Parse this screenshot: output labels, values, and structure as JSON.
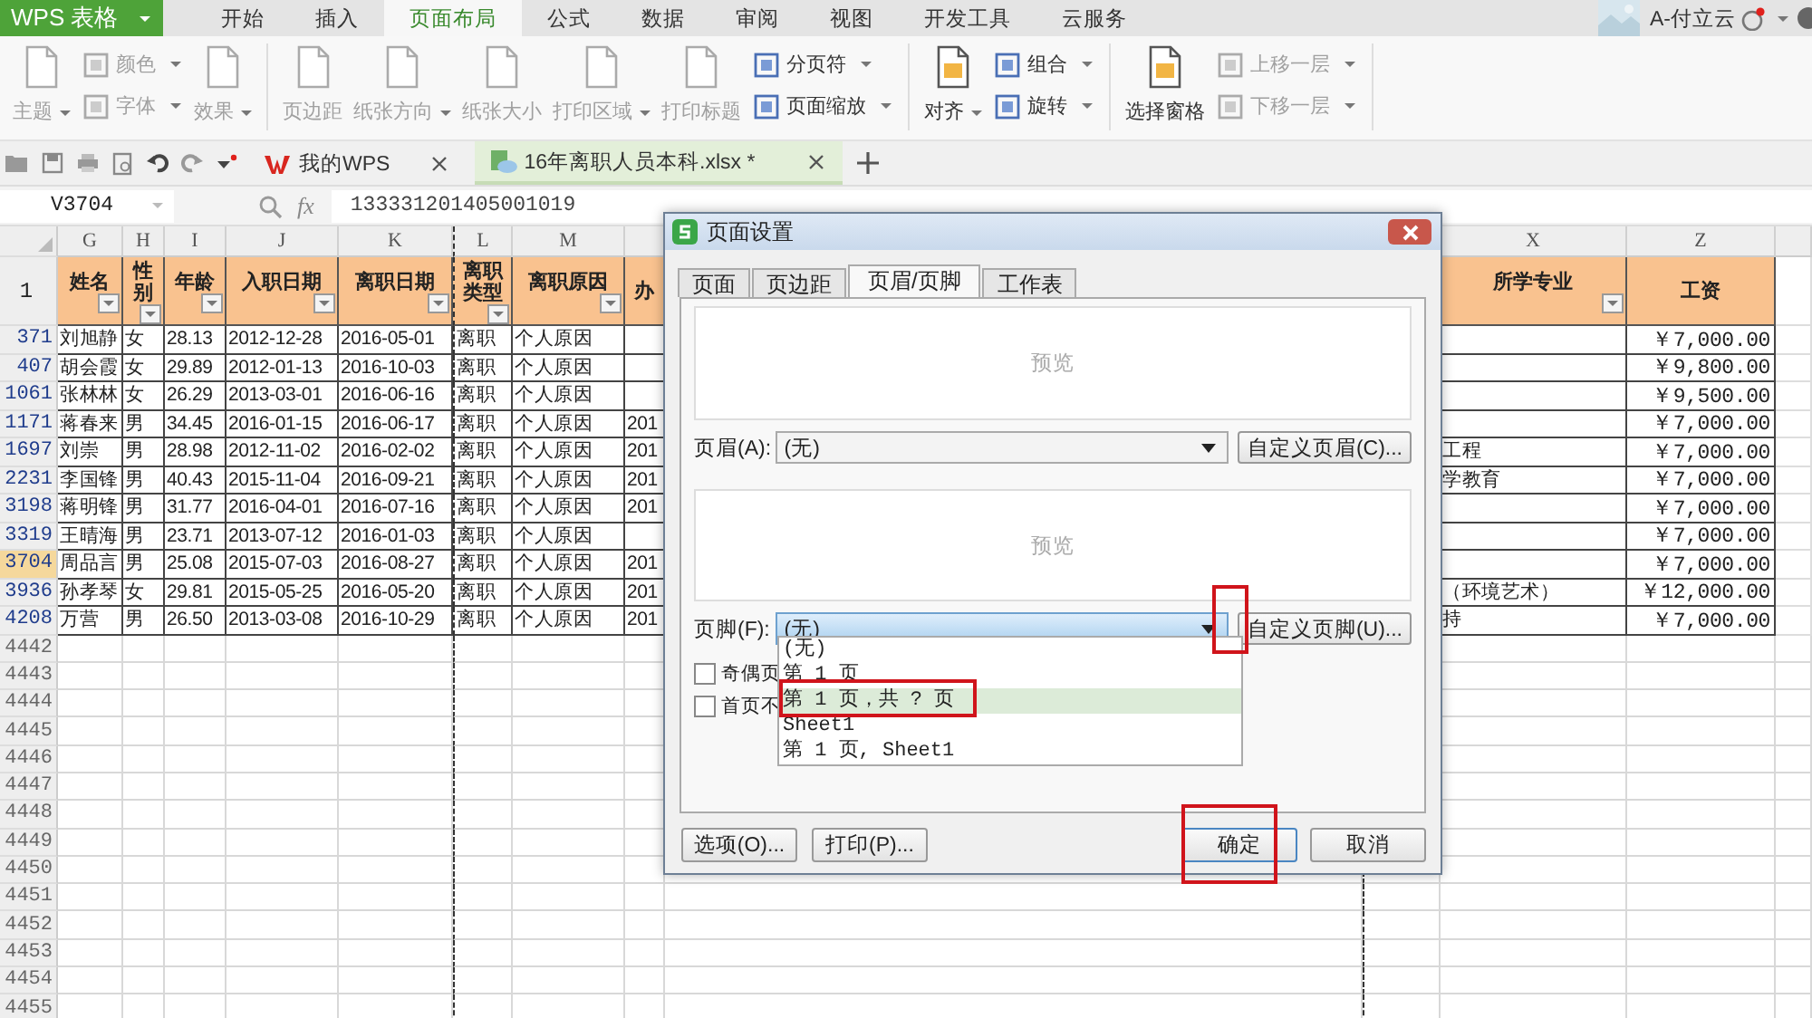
{
  "app": {
    "name": "WPS 表格"
  },
  "menu_tabs": [
    {
      "label": "开始",
      "selected": false
    },
    {
      "label": "插入",
      "selected": false
    },
    {
      "label": "页面布局",
      "selected": true
    },
    {
      "label": "公式",
      "selected": false
    },
    {
      "label": "数据",
      "selected": false
    },
    {
      "label": "审阅",
      "selected": false
    },
    {
      "label": "视图",
      "selected": false
    },
    {
      "label": "开发工具",
      "selected": false
    },
    {
      "label": "云服务",
      "selected": false
    }
  ],
  "user": {
    "name": "A-付立云"
  },
  "ribbon": [
    {
      "kind": "large",
      "label": "主题",
      "dropdown": true,
      "disabled": true
    },
    {
      "kind": "stack",
      "items": [
        {
          "label": "颜色",
          "dropdown": true,
          "disabled": true
        },
        {
          "label": "字体",
          "dropdown": true,
          "disabled": true
        }
      ]
    },
    {
      "kind": "large",
      "label": "效果",
      "dropdown": true,
      "disabled": true
    },
    {
      "kind": "separator"
    },
    {
      "kind": "large",
      "label": "页边距",
      "dropdown": false,
      "disabled": true
    },
    {
      "kind": "large",
      "label": "纸张方向",
      "dropdown": true,
      "disabled": true
    },
    {
      "kind": "large",
      "label": "纸张大小",
      "dropdown": false,
      "disabled": true
    },
    {
      "kind": "large",
      "label": "打印区域",
      "dropdown": true,
      "disabled": true
    },
    {
      "kind": "large",
      "label": "打印标题",
      "dropdown": false,
      "disabled": true
    },
    {
      "kind": "stack",
      "items": [
        {
          "label": "分页符",
          "dropdown": true,
          "disabled": false
        },
        {
          "label": "页面缩放",
          "dropdown": true,
          "disabled": false
        }
      ]
    },
    {
      "kind": "separator"
    },
    {
      "kind": "large",
      "label": "对齐",
      "dropdown": true,
      "disabled": false
    },
    {
      "kind": "stack",
      "items": [
        {
          "label": "组合",
          "dropdown": true,
          "disabled": false
        },
        {
          "label": "旋转",
          "dropdown": true,
          "disabled": false
        }
      ]
    },
    {
      "kind": "separator"
    },
    {
      "kind": "large",
      "label": "选择窗格",
      "dropdown": false,
      "disabled": false
    },
    {
      "kind": "stack",
      "items": [
        {
          "label": "上移一层",
          "dropdown": true,
          "disabled": true
        },
        {
          "label": "下移一层",
          "dropdown": true,
          "disabled": true
        }
      ]
    },
    {
      "kind": "separator"
    }
  ],
  "doc_tabs": [
    {
      "label": "我的WPS",
      "selected": false
    },
    {
      "label": "16年离职人员本科.xlsx *",
      "selected": true
    }
  ],
  "formula_bar": {
    "name_box": "V3704",
    "function_label": "fx",
    "value": "133331201405001019"
  },
  "sheet": {
    "columns": [
      {
        "letter": "G",
        "label": "姓名",
        "filter": true
      },
      {
        "letter": "H",
        "label": "性别",
        "filter": true
      },
      {
        "letter": "I",
        "label": "年龄",
        "filter": true
      },
      {
        "letter": "J",
        "label": "入职日期",
        "filter": true
      },
      {
        "letter": "K",
        "label": "离职日期",
        "filter": true
      },
      {
        "letter": "L",
        "label": "离职类型",
        "filter": true
      },
      {
        "letter": "M",
        "label": "离职原因",
        "filter": true
      },
      {
        "label": "办",
        "filter": false
      },
      {
        "letter": "X",
        "label": "所学专业",
        "filter": true
      },
      {
        "letter": "Z",
        "label": "工资",
        "filter": false
      }
    ],
    "header_row": "1",
    "rows": [
      {
        "row": "371",
        "selected": false,
        "name": "刘旭静",
        "gender": "女",
        "age": "28.13",
        "hire_date": "2012-12-28",
        "leave_date": "2016-05-01",
        "leave_type": "离职",
        "leave_reason": "个人原因",
        "salary": "￥7,000.00"
      },
      {
        "row": "407",
        "selected": false,
        "name": "胡会霞",
        "gender": "女",
        "age": "29.89",
        "hire_date": "2012-01-13",
        "leave_date": "2016-10-03",
        "leave_type": "离职",
        "leave_reason": "个人原因",
        "salary": "￥9,800.00"
      },
      {
        "row": "1061",
        "selected": false,
        "name": "张林林",
        "gender": "女",
        "age": "26.29",
        "hire_date": "2013-03-01",
        "leave_date": "2016-06-16",
        "leave_type": "离职",
        "leave_reason": "个人原因",
        "salary": "￥9,500.00"
      },
      {
        "row": "1171",
        "selected": false,
        "name": "蒋春来",
        "gender": "男",
        "age": "34.45",
        "hire_date": "2016-01-15",
        "leave_date": "2016-06-17",
        "leave_type": "离职",
        "leave_reason": "个人原因",
        "column_8": "201",
        "salary": "￥7,000.00"
      },
      {
        "row": "1697",
        "selected": false,
        "name": "刘崇",
        "gender": "男",
        "age": "28.98",
        "hire_date": "2012-11-02",
        "leave_date": "2016-02-02",
        "leave_type": "离职",
        "leave_reason": "个人原因",
        "column_8": "201",
        "major": "工程",
        "salary": "￥7,000.00"
      },
      {
        "row": "2231",
        "selected": false,
        "name": "李国锋",
        "gender": "男",
        "age": "40.43",
        "hire_date": "2015-11-04",
        "leave_date": "2016-09-21",
        "leave_type": "离职",
        "leave_reason": "个人原因",
        "column_8": "201",
        "major": "学教育",
        "salary": "￥7,000.00"
      },
      {
        "row": "3198",
        "selected": false,
        "name": "蒋明锋",
        "gender": "男",
        "age": "31.77",
        "hire_date": "2016-04-01",
        "leave_date": "2016-07-16",
        "leave_type": "离职",
        "leave_reason": "个人原因",
        "column_8": "201",
        "salary": "￥7,000.00"
      },
      {
        "row": "3319",
        "selected": false,
        "name": "王晴海",
        "gender": "男",
        "age": "23.71",
        "hire_date": "2013-07-12",
        "leave_date": "2016-01-03",
        "leave_type": "离职",
        "leave_reason": "个人原因",
        "salary": "￥7,000.00"
      },
      {
        "row": "3704",
        "selected": true,
        "name": "周品言",
        "gender": "男",
        "age": "25.08",
        "hire_date": "2015-07-03",
        "leave_date": "2016-08-27",
        "leave_type": "离职",
        "leave_reason": "个人原因",
        "column_8": "201",
        "salary": "￥7,000.00"
      },
      {
        "row": "3936",
        "selected": false,
        "name": "孙孝琴",
        "gender": "女",
        "age": "29.81",
        "hire_date": "2015-05-25",
        "leave_date": "2016-05-20",
        "leave_type": "离职",
        "leave_reason": "个人原因",
        "column_8": "201",
        "major": "（环境艺术）",
        "salary": "￥12,000.00"
      },
      {
        "row": "4208",
        "selected": false,
        "name": "万营",
        "gender": "男",
        "age": "26.50",
        "hire_date": "2013-03-08",
        "leave_date": "2016-10-29",
        "leave_type": "离职",
        "leave_reason": "个人原因",
        "column_8": "201",
        "major": "持",
        "salary": "￥7,000.00"
      }
    ],
    "empty_rows": [
      "4442",
      "4443",
      "4444",
      "4445",
      "4446",
      "4447",
      "4448",
      "4449",
      "4450",
      "4451",
      "4452",
      "4453",
      "4454",
      "4455"
    ]
  },
  "dialog": {
    "title": "页面设置",
    "tabs": [
      {
        "label": "页面",
        "selected": false
      },
      {
        "label": "页边距",
        "selected": false
      },
      {
        "label": "页眉/页脚",
        "selected": true
      },
      {
        "label": "工作表",
        "selected": false
      }
    ],
    "header_preview": "预览",
    "header_field": {
      "label": "页眉(A):",
      "value": "(无)",
      "open": false
    },
    "header_button": "自定义页眉(C)...",
    "footer_preview": "预览",
    "footer_field": {
      "label": "页脚(F):",
      "value": "(无)",
      "open": true
    },
    "footer_button": "自定义页脚(U)...",
    "footer_options": [
      {
        "label": "(无)",
        "selected": false
      },
      {
        "label": "第 1 页",
        "selected": false
      },
      {
        "label": "第 1 页，共 ? 页",
        "selected": true
      },
      {
        "label": "Sheet1",
        "selected": false
      },
      {
        "label": "第 1 页, Sheet1",
        "selected": false
      }
    ],
    "checkboxes": [
      {
        "label": "奇偶页",
        "checked": false
      },
      {
        "label": "首页不",
        "checked": false
      }
    ],
    "buttons": [
      {
        "label": "选项(O)...",
        "default": false
      },
      {
        "label": "打印(P)...",
        "default": false
      },
      {
        "label": "确定",
        "default": true
      },
      {
        "label": "取消",
        "default": false
      }
    ],
    "annotations": [
      {
        "kind": "dropdown-arrow"
      },
      {
        "kind": "option"
      },
      {
        "kind": "ok-button"
      }
    ]
  }
}
